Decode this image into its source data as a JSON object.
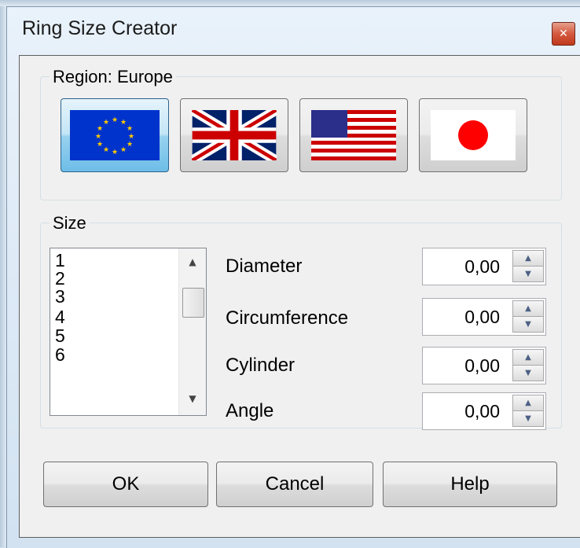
{
  "window": {
    "title": "Ring Size Creator"
  },
  "region": {
    "label": "Region: Europe",
    "flags": [
      {
        "name": "Europe",
        "selected": true
      },
      {
        "name": "United Kingdom",
        "selected": false
      },
      {
        "name": "United States",
        "selected": false
      },
      {
        "name": "Japan",
        "selected": false
      }
    ]
  },
  "size": {
    "label": "Size",
    "list": [
      "1",
      "2",
      "3",
      "4",
      "5",
      "6"
    ],
    "fields": [
      {
        "label": "Diameter",
        "value": "0,00"
      },
      {
        "label": "Circumference",
        "value": "0,00"
      },
      {
        "label": "Cylinder",
        "value": "0,00"
      },
      {
        "label": "Angle",
        "value": "0,00"
      }
    ]
  },
  "buttons": {
    "ok": "OK",
    "cancel": "Cancel",
    "help": "Help"
  },
  "icons": {
    "close": "close-icon",
    "scroll_up": "scroll-up-icon",
    "scroll_down": "scroll-down-icon"
  },
  "colors": {
    "eu_blue": "#0033cc",
    "eu_star": "#ffcc00",
    "uk_red": "#cc0000",
    "jp_red": "#ff0000"
  }
}
